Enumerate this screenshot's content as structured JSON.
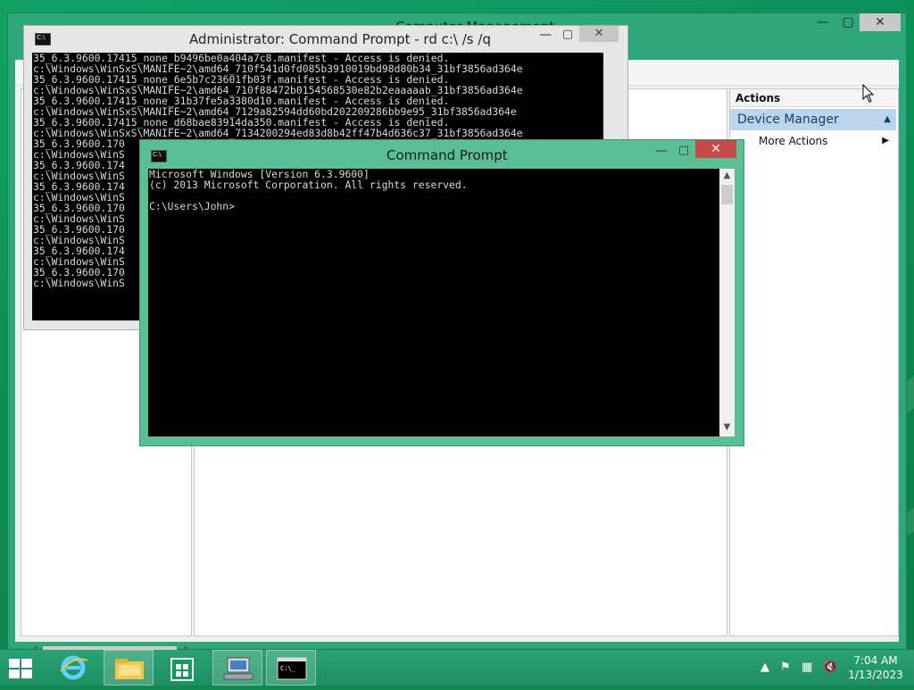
{
  "cm_window": {
    "title": "Computer Management",
    "actions_header": "Actions",
    "actions_section": "Device Manager",
    "more_actions": "More Actions"
  },
  "admin_cmd": {
    "title": "Administrator: Command Prompt - rd  c:\\ /s /q",
    "output": "35_6.3.9600.17415_none_b9496be0a404a7c8.manifest - Access is denied.\nc:\\Windows\\WinSxS\\MANIFE~2\\amd64_710f541d0fd085b3910019bd98d80b34_31bf3856ad364e\n35_6.3.9600.17415_none_6e5b7c23601fb03f.manifest - Access is denied.\nc:\\Windows\\WinSxS\\MANIFE~2\\amd64_710f88472b0154568530e82b2eaaaaab_31bf3856ad364e\n35_6.3.9600.17415_none_31b37fe5a3380d10.manifest - Access is denied.\nc:\\Windows\\WinSxS\\MANIFE~2\\amd64_7129a82594dd60bd202209286bb9e95_31bf3856ad364e\n35_6.3.9600.17415_none_d68bae83914da350.manifest - Access is denied.\nc:\\Windows\\WinSxS\\MANIFE~2\\amd64_7134200294ed83d8b42ff47b4d636c37_31bf3856ad364e\n35_6.3.9600.170\nc:\\Windows\\WinS\n35_6.3.9600.174\nc:\\Windows\\WinS\n35_6.3.9600.174\nc:\\Windows\\WinS\n35_6.3.9600.170\nc:\\Windows\\WinS\n35_6.3.9600.170\nc:\\Windows\\WinS\n35_6.3.9600.174\nc:\\Windows\\WinS\n35_6.3.9600.170\nc:\\Windows\\WinS"
  },
  "cmd": {
    "title": "Command Prompt",
    "output": "Microsoft Windows [Version 6.3.9600]\n(c) 2013 Microsoft Corporation. All rights reserved.\n\nC:\\Users\\John>"
  },
  "taskbar": {
    "items": [
      {
        "icon": "internet-explorer-icon"
      },
      {
        "icon": "file-explorer-icon"
      },
      {
        "icon": "store-icon"
      },
      {
        "icon": "computer-management-icon"
      },
      {
        "icon": "command-prompt-icon"
      }
    ],
    "time": "7:04 AM",
    "date": "1/13/2023"
  },
  "colors": {
    "desktop": "#0f8a55",
    "active_titlebar": "#5bbf95",
    "close_active": "#c84a48"
  }
}
